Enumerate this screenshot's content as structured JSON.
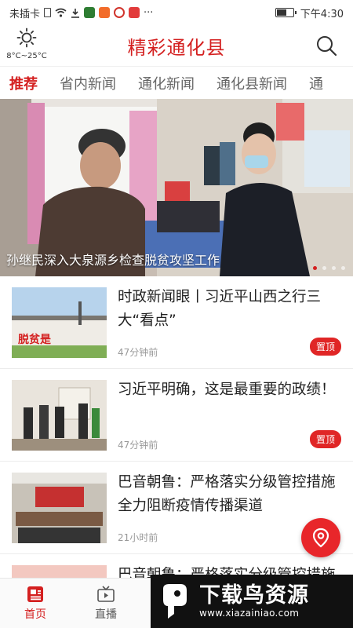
{
  "status_bar": {
    "carrier": "未插卡",
    "more": "···",
    "time": "下午4:30"
  },
  "header": {
    "weather": "8°C~25°C",
    "title": "精彩通化县"
  },
  "tabs": [
    {
      "label": "推荐"
    },
    {
      "label": "省内新闻"
    },
    {
      "label": "通化新闻"
    },
    {
      "label": "通化县新闻"
    },
    {
      "label": "通"
    }
  ],
  "banner": {
    "caption": "孙继民深入大泉源乡检查脱贫攻坚工作"
  },
  "news": [
    {
      "title": "时政新闻眼丨习近平山西之行三大“看点”",
      "time": "47分钟前",
      "badge": "置顶",
      "thumb_text": "脱贫是"
    },
    {
      "title": "习近平明确，这是最重要的政绩！",
      "time": "47分钟前",
      "badge": "置顶"
    },
    {
      "title": "巴音朝鲁：严格落实分级管控措施 全力阻断疫情传播渠道",
      "time": "21小时前"
    },
    {
      "title": "巴音朝鲁：严格落实分级管控措施"
    }
  ],
  "bottom_nav": [
    {
      "label": "首页"
    },
    {
      "label": "直播"
    }
  ],
  "watermark": {
    "brand": "下载鸟资源",
    "url": "www.xiazainiao.com"
  },
  "colors": {
    "accent": "#d42020",
    "badge": "#e02626"
  }
}
